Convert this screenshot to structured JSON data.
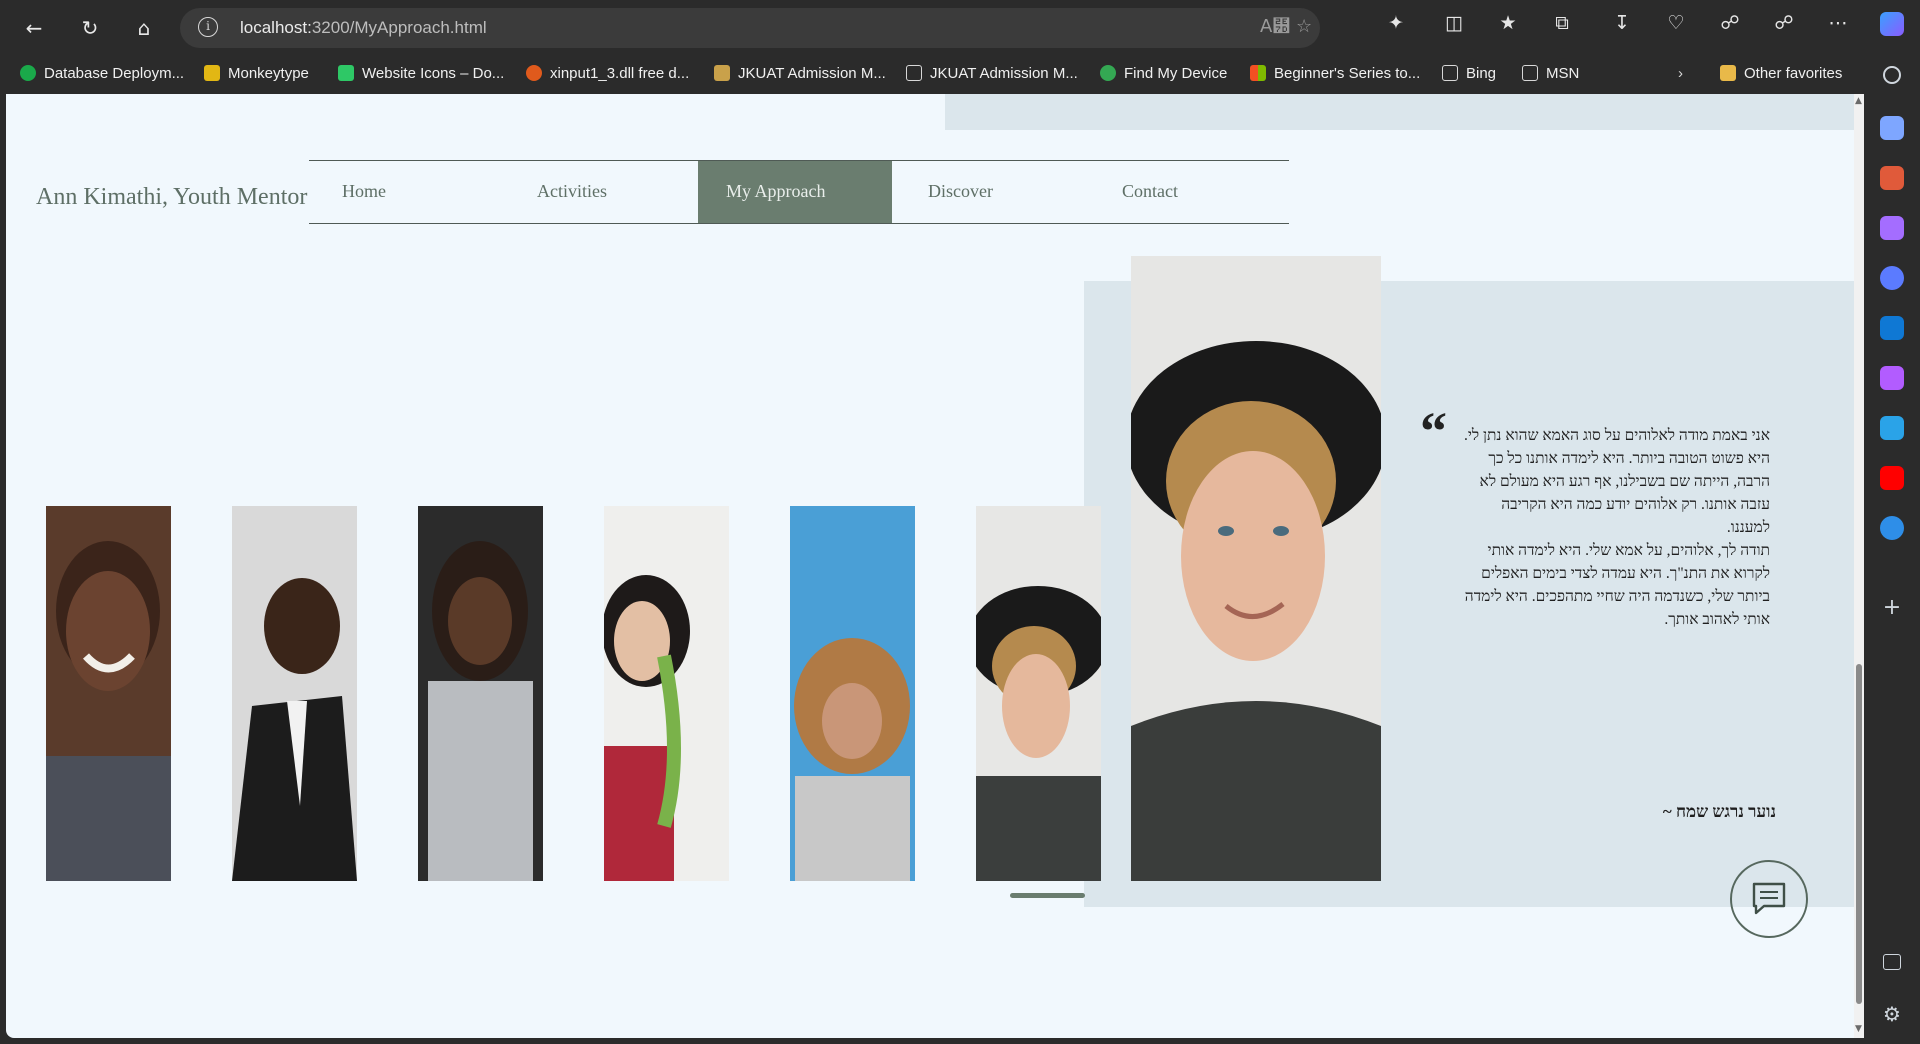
{
  "browser": {
    "url_host": "localhost:",
    "url_rest": "3200/MyApproach.html",
    "bookmarks": [
      {
        "label": "Database Deploym...",
        "color": "#1aa94a"
      },
      {
        "label": "Monkeytype",
        "color": "#e2b714"
      },
      {
        "label": "Website Icons – Do...",
        "color": "#2ec866"
      },
      {
        "label": "xinput1_3.dll free d...",
        "color": "#e05a1c"
      },
      {
        "label": "JKUAT Admission M...",
        "color": "#c9a14a"
      },
      {
        "label": "JKUAT Admission M...",
        "color": "#d8d8d8"
      },
      {
        "label": "Find My Device",
        "color": "#34a853"
      },
      {
        "label": "Beginner's Series to...",
        "color": "#f25022"
      },
      {
        "label": "Bing",
        "color": "#d8d8d8"
      },
      {
        "label": "MSN",
        "color": "#d8d8d8"
      }
    ],
    "other_favorites": "Other favorites"
  },
  "site": {
    "brand": "Ann Kimathi, Youth Mentor",
    "nav": [
      {
        "label": "Home",
        "active": false
      },
      {
        "label": "Activities",
        "active": false
      },
      {
        "label": "My Approach",
        "active": true
      },
      {
        "label": "Discover",
        "active": false
      },
      {
        "label": "Contact",
        "active": false
      }
    ]
  },
  "testimonial": {
    "quote_mark": "“",
    "text": "אני באמת מודה לאלוהים על סוג האמא שהוא נתן לי. היא פשוט הטובה ביותר. היא לימדה אותנו כל כך הרבה, הייתה שם בשבילנו, אף רגע היא מעולם לא עזבה אותנו. רק אלוהים יודע כמה היא הקריבה למעננו.\nתודה לך, אלוהים, על אמא שלי. היא לימדה אותי לקרוא את התנ\"ך. היא עמדה לצדי בימים האפלים ביותר שלי, כשנדמה היה שחיי מתהפכים. היא לימדה אותי לאהוב אותך.",
    "author": "נוער נרגש שמח ~"
  },
  "colors": {
    "accent": "#6a7d6f",
    "page_bg": "#f1f8fd",
    "panel_bg": "#dbe6ec"
  }
}
